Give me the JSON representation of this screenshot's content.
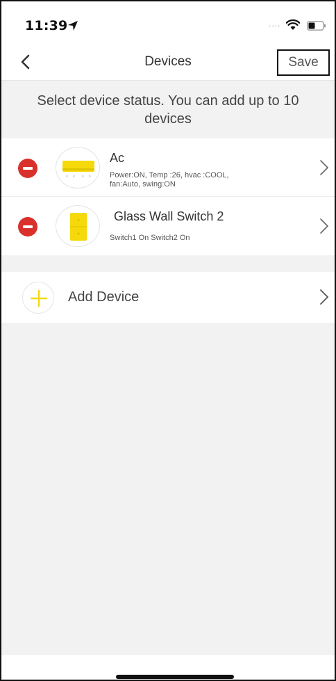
{
  "status_bar": {
    "time": "11:39",
    "signal": "....",
    "icons": [
      "location-arrow-icon",
      "wifi-icon",
      "battery-icon"
    ]
  },
  "nav": {
    "title": "Devices",
    "save_label": "Save",
    "back_icon": "chevron-left-icon"
  },
  "instruction": "Select device status. You can add up to 10 devices",
  "devices": [
    {
      "name": "Ac",
      "status_line1": "Power:ON, Temp :26, hvac :COOL,",
      "status_line2": "fan:Auto, swing:ON",
      "icon": "air-conditioner-icon"
    },
    {
      "name": "Glass Wall Switch 2",
      "status_line1": "Switch1 On Switch2 On",
      "status_line2": "",
      "icon": "wall-switch-icon"
    }
  ],
  "add_device": {
    "label": "Add Device",
    "icon": "plus-icon"
  },
  "colors": {
    "remove": "#d9302c",
    "accent_yellow": "#f5d90a",
    "background": "#f2f2f2"
  }
}
